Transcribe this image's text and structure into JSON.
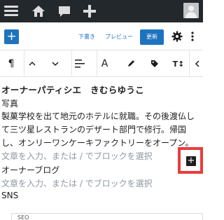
{
  "admin_bar": {
    "icons": [
      "menu-icon",
      "home-icon",
      "comment-icon",
      "plus-icon",
      "avatar-icon"
    ]
  },
  "editor_header": {
    "inserter_label": "+",
    "save_draft_label": "下書き",
    "preview_label": "プレビュー",
    "update_label": "更新"
  },
  "block_toolbar": {
    "icons": [
      "paragraph-icon",
      "move-up-icon",
      "move-down-icon",
      "align-icon",
      "format-icon",
      "highlighter-icon",
      "tag-icon",
      "font-size-icon",
      "more-arrow-icon"
    ],
    "paragraph_glyph": "¶",
    "text_glyph": "A",
    "font_size_glyph": "T↕"
  },
  "content": {
    "heading": "オーナーパティシエ　きむらゆうこ",
    "photo_label": "写真",
    "bio_lines": [
      "製菓学校を出て地元のホテルに就職。その後渡仏し",
      "て三ツ星レストランのデザート部門で修行。帰国",
      "し、オンリーワンケーキファクトリーをオープン。"
    ],
    "placeholder_1": "文章を入力、または / でブロックを選択",
    "blog_label": "オーナーブログ",
    "placeholder_2": "文章を入力、または / でブロックを選択",
    "sns_label": "SNS",
    "add_block_label": "+"
  },
  "bottom_panel": {
    "label": "SEO"
  }
}
